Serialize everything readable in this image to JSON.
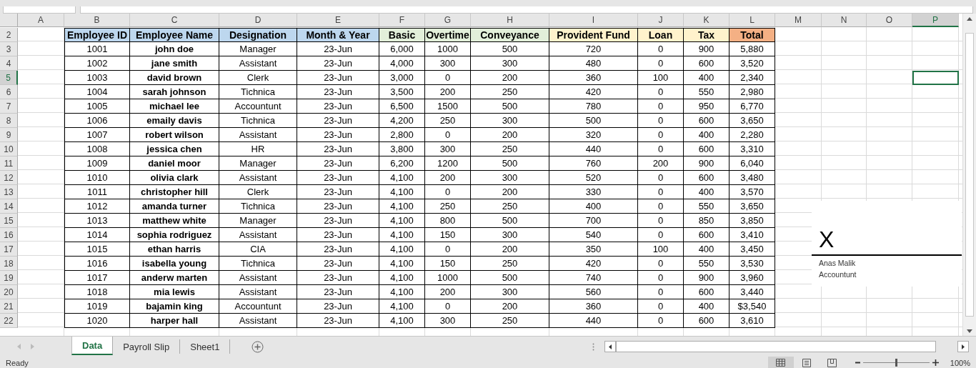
{
  "columns": [
    {
      "label": "A",
      "selected": false
    },
    {
      "label": "B",
      "selected": false
    },
    {
      "label": "C",
      "selected": false
    },
    {
      "label": "D",
      "selected": false
    },
    {
      "label": "E",
      "selected": false
    },
    {
      "label": "F",
      "selected": false
    },
    {
      "label": "G",
      "selected": false
    },
    {
      "label": "H",
      "selected": false
    },
    {
      "label": "I",
      "selected": false
    },
    {
      "label": "J",
      "selected": false
    },
    {
      "label": "K",
      "selected": false
    },
    {
      "label": "L",
      "selected": false
    },
    {
      "label": "M",
      "selected": false
    },
    {
      "label": "N",
      "selected": false
    },
    {
      "label": "O",
      "selected": false
    },
    {
      "label": "P",
      "selected": true
    }
  ],
  "header_row": {
    "row": "2",
    "cells": [
      {
        "text": "Employee ID",
        "color": "#bdd7ee"
      },
      {
        "text": "Employee Name",
        "color": "#bdd7ee"
      },
      {
        "text": "Designation",
        "color": "#bdd7ee"
      },
      {
        "text": "Month & Year",
        "color": "#bdd7ee"
      },
      {
        "text": "Basic",
        "color": "#e2efda"
      },
      {
        "text": "Overtime",
        "color": "#e2efda"
      },
      {
        "text": "Conveyance",
        "color": "#e2efda"
      },
      {
        "text": "Provident Fund",
        "color": "#fff2cc"
      },
      {
        "text": "Loan",
        "color": "#fff2cc"
      },
      {
        "text": "Tax",
        "color": "#fff2cc"
      },
      {
        "text": "Total",
        "color": "#f4b084"
      }
    ]
  },
  "rows": [
    {
      "row": "3",
      "selected": false,
      "cells": [
        "1001",
        "john doe",
        "Manager",
        "23-Jun",
        "6,000",
        "1000",
        "500",
        "720",
        "0",
        "900",
        "5,880"
      ]
    },
    {
      "row": "4",
      "selected": false,
      "cells": [
        "1002",
        "jane smith",
        "Assistant",
        "23-Jun",
        "4,000",
        "300",
        "300",
        "480",
        "0",
        "600",
        "3,520"
      ]
    },
    {
      "row": "5",
      "selected": true,
      "cells": [
        "1003",
        "david brown",
        "Clerk",
        "23-Jun",
        "3,000",
        "0",
        "200",
        "360",
        "100",
        "400",
        "2,340"
      ]
    },
    {
      "row": "6",
      "selected": false,
      "cells": [
        "1004",
        "sarah johnson",
        "Tichnica",
        "23-Jun",
        "3,500",
        "200",
        "250",
        "420",
        "0",
        "550",
        "2,980"
      ]
    },
    {
      "row": "7",
      "selected": false,
      "cells": [
        "1005",
        "michael lee",
        "Accountunt",
        "23-Jun",
        "6,500",
        "1500",
        "500",
        "780",
        "0",
        "950",
        "6,770"
      ]
    },
    {
      "row": "8",
      "selected": false,
      "cells": [
        "1006",
        "emaily davis",
        "Tichnica",
        "23-Jun",
        "4,200",
        "250",
        "300",
        "500",
        "0",
        "600",
        "3,650"
      ]
    },
    {
      "row": "9",
      "selected": false,
      "cells": [
        "1007",
        "robert wilson",
        "Assistant",
        "23-Jun",
        "2,800",
        "0",
        "200",
        "320",
        "0",
        "400",
        "2,280"
      ]
    },
    {
      "row": "10",
      "selected": false,
      "cells": [
        "1008",
        "jessica chen",
        "HR",
        "23-Jun",
        "3,800",
        "300",
        "250",
        "440",
        "0",
        "600",
        "3,310"
      ]
    },
    {
      "row": "11",
      "selected": false,
      "cells": [
        "1009",
        "daniel moor",
        "Manager",
        "23-Jun",
        "6,200",
        "1200",
        "500",
        "760",
        "200",
        "900",
        "6,040"
      ]
    },
    {
      "row": "12",
      "selected": false,
      "cells": [
        "1010",
        "olivia clark",
        "Assistant",
        "23-Jun",
        "4,100",
        "200",
        "300",
        "520",
        "0",
        "600",
        "3,480"
      ]
    },
    {
      "row": "13",
      "selected": false,
      "cells": [
        "1011",
        "christopher hill",
        "Clerk",
        "23-Jun",
        "4,100",
        "0",
        "200",
        "330",
        "0",
        "400",
        "3,570"
      ]
    },
    {
      "row": "14",
      "selected": false,
      "cells": [
        "1012",
        "amanda turner",
        "Tichnica",
        "23-Jun",
        "4,100",
        "250",
        "250",
        "400",
        "0",
        "550",
        "3,650"
      ]
    },
    {
      "row": "15",
      "selected": false,
      "cells": [
        "1013",
        "matthew white",
        "Manager",
        "23-Jun",
        "4,100",
        "800",
        "500",
        "700",
        "0",
        "850",
        "3,850"
      ]
    },
    {
      "row": "16",
      "selected": false,
      "cells": [
        "1014",
        "sophia rodriguez",
        "Assistant",
        "23-Jun",
        "4,100",
        "150",
        "300",
        "540",
        "0",
        "600",
        "3,410"
      ]
    },
    {
      "row": "17",
      "selected": false,
      "cells": [
        "1015",
        "ethan harris",
        "CIA",
        "23-Jun",
        "4,100",
        "0",
        "200",
        "350",
        "100",
        "400",
        "3,450"
      ]
    },
    {
      "row": "18",
      "selected": false,
      "cells": [
        "1016",
        "isabella young",
        "Tichnica",
        "23-Jun",
        "4,100",
        "150",
        "250",
        "420",
        "0",
        "550",
        "3,530"
      ]
    },
    {
      "row": "19",
      "selected": false,
      "cells": [
        "1017",
        "anderw marten",
        "Assistant",
        "23-Jun",
        "4,100",
        "1000",
        "500",
        "740",
        "0",
        "900",
        "3,960"
      ]
    },
    {
      "row": "20",
      "selected": false,
      "cells": [
        "1018",
        "mia lewis",
        "Assistant",
        "23-Jun",
        "4,100",
        "200",
        "300",
        "560",
        "0",
        "600",
        "3,440"
      ]
    },
    {
      "row": "21",
      "selected": false,
      "cells": [
        "1019",
        "bajamin king",
        "Accountunt",
        "23-Jun",
        "4,100",
        "0",
        "200",
        "360",
        "0",
        "400",
        "$3,540"
      ]
    },
    {
      "row": "22",
      "selected": false,
      "cells": [
        "1020",
        "harper hall",
        "Assistant",
        "23-Jun",
        "4,100",
        "300",
        "250",
        "440",
        "0",
        "600",
        "3,610"
      ]
    }
  ],
  "signature": {
    "mark": "X",
    "name": "Anas Malik",
    "title": "Accountunt"
  },
  "sheet_tabs": [
    {
      "label": "Data",
      "selected": true
    },
    {
      "label": "Payroll Slip",
      "selected": false
    },
    {
      "label": "Sheet1",
      "selected": false
    }
  ],
  "status_bar": {
    "text": "Ready",
    "zoom": "100%",
    "zoom_slider": {
      "level": 0.5
    }
  }
}
